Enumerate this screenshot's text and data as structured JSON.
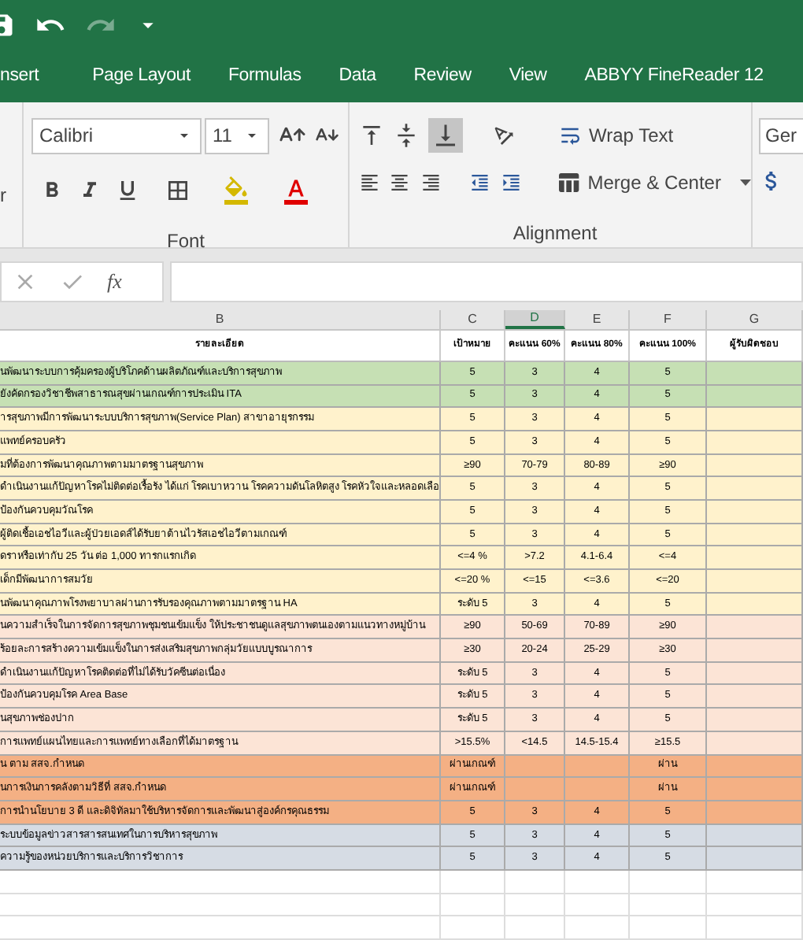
{
  "ribbon_tabs": [
    {
      "label": "nsert",
      "selected": false
    },
    {
      "label": "Page Layout",
      "selected": false
    },
    {
      "label": "Formulas",
      "selected": false
    },
    {
      "label": "Data",
      "selected": false
    },
    {
      "label": "Review",
      "selected": false
    },
    {
      "label": "View",
      "selected": false
    },
    {
      "label": "ABBYY FineReader 12",
      "selected": false
    }
  ],
  "clipboard_group": {
    "cut_label": "r"
  },
  "font_group": {
    "font_name": "Calibri",
    "font_size": "11",
    "label": "Font"
  },
  "alignment_group": {
    "wrap_text": "Wrap Text",
    "merge_center": "Merge & Center",
    "label": "Alignment",
    "bottom_align_selected": true
  },
  "number_group": {
    "format": "Ger"
  },
  "formula_bar": {
    "fx": "fx"
  },
  "columns": [
    {
      "letter": "B",
      "selected": false
    },
    {
      "letter": "C",
      "selected": false
    },
    {
      "letter": "D",
      "selected": true
    },
    {
      "letter": "E",
      "selected": false
    },
    {
      "letter": "F",
      "selected": false
    },
    {
      "letter": "G",
      "selected": false
    }
  ],
  "header_row": [
    "รายละเอียด",
    "เป้าหมาย",
    "คะแนน 60%",
    "คะแนน 80%",
    "คะแนน 100%",
    "ผู้รับผิดชอบ"
  ],
  "rows": [
    {
      "color": "#c6e0b4",
      "cells": [
        "นพัฒนาระบบการคุ้มครองผู้บริโภคด้านผลิตภัณฑ์และบริการสุขภาพ",
        "5",
        "3",
        "4",
        "5"
      ]
    },
    {
      "color": "#c6e0b4",
      "cells": [
        "ยังคัดกรองวิชาชีพสาธารณสุขผ่านเกณฑ์การประเมิน ITA",
        "5",
        "3",
        "4",
        "5"
      ]
    },
    {
      "color": "#fff2cc",
      "cells": [
        "ารสุขภาพมีการพัฒนาระบบบริการสุขภาพ(Service Plan) สาขาอายุรกรรม",
        "5",
        "3",
        "4",
        "5"
      ]
    },
    {
      "color": "#fff2cc",
      "cells": [
        "แพทย์ครอบครัว",
        "5",
        "3",
        "4",
        "5"
      ]
    },
    {
      "color": "#fff2cc",
      "cells": [
        "มที่ต้องการพัฒนาคุณภาพตามมาตรฐานสุขภาพ",
        "≥90",
        "70-79",
        "80-89",
        "≥90"
      ]
    },
    {
      "color": "#fff2cc",
      "cells": [
        "ดำเนินงานแก้ปัญหาโรคไม่ติดต่อเรื้อรัง ได้แก่ โรคเบาหวาน โรคความดันโลหิตสูง โรคหัวใจและหลอดเลือ",
        "5",
        "3",
        "4",
        "5"
      ]
    },
    {
      "color": "#fff2cc",
      "cells": [
        "ป้องกันควบคุมวัณโรค",
        "5",
        "3",
        "4",
        "5"
      ]
    },
    {
      "color": "#fff2cc",
      "cells": [
        "ผู้ติดเชื้อเอชไอวีและผู้ป่วยเอดส์ได้รับยาต้านไวรัสเอชไอวีตามเกณฑ์",
        "5",
        "3",
        "4",
        "5"
      ]
    },
    {
      "color": "#fff2cc",
      "cells": [
        "ดราหรือเท่ากับ 25 วัน ต่อ 1,000 ทารกแรกเกิด",
        "<=4 %",
        ">7.2",
        "4.1-6.4",
        "<=4"
      ]
    },
    {
      "color": "#fff2cc",
      "cells": [
        "เด็กมีพัฒนาการสมวัย",
        "<=20 %",
        "<=15",
        "<=3.6",
        "<=20"
      ]
    },
    {
      "color": "#fff2cc",
      "cells": [
        "นพัฒนาคุณภาพโรงพยาบาลผ่านการรับรองคุณภาพตามมาตรฐาน HA",
        "ระดับ 5",
        "3",
        "4",
        "5"
      ]
    },
    {
      "color": "#fce4d6",
      "cells": [
        "นความสำเร็จในการจัดการสุขภาพชุมชนเข้มแข็ง ให้ประชาชนดูแลสุขภาพตนเองตามแนวทางหมู่บ้าน",
        "≥90",
        "50-69",
        "70-89",
        "≥90"
      ]
    },
    {
      "color": "#fce4d6",
      "cells": [
        "ร้อยละการสร้างความเข้มแข็งในการส่งเสริมสุขภาพกลุ่มวัยแบบบูรณาการ",
        "≥30",
        "20-24",
        "25-29",
        "≥30"
      ]
    },
    {
      "color": "#fce4d6",
      "cells": [
        "ดำเนินงานแก้ปัญหาโรคติดต่อที่ไม่ได้รับวัคซีนต่อเนื่อง",
        "ระดับ 5",
        "3",
        "4",
        "5"
      ]
    },
    {
      "color": "#fce4d6",
      "cells": [
        "ป้องกันควบคุมโรค Area Base",
        "ระดับ 5",
        "3",
        "4",
        "5"
      ]
    },
    {
      "color": "#fce4d6",
      "cells": [
        "นสุขภาพช่องปาก",
        "ระดับ 5",
        "3",
        "4",
        "5"
      ]
    },
    {
      "color": "#fce4d6",
      "cells": [
        "การแพทย์แผนไทยและการแพทย์ทางเลือกที่ได้มาตรฐาน",
        ">15.5%",
        "<14.5",
        "14.5-15.4",
        "≥15.5"
      ]
    },
    {
      "color": "#f4b084",
      "cells": [
        "น ตาม สสจ.กำหนด",
        "ผ่านเกณฑ์",
        "",
        "",
        "ผ่าน"
      ]
    },
    {
      "color": "#f4b084",
      "cells": [
        "นการเงินการคลังตามวิธีที่ สสจ.กำหนด",
        "ผ่านเกณฑ์",
        "",
        "",
        "ผ่าน"
      ]
    },
    {
      "color": "#f4b084",
      "cells": [
        "การนำนโยบาย 3 ดี และดิจิทัลมาใช้บริหารจัดการและพัฒนาสู่องค์กรคุณธรรม",
        "5",
        "3",
        "4",
        "5"
      ]
    },
    {
      "color": "#d6dce4",
      "cells": [
        "ระบบข้อมูลข่าวสารสารสนเทศในการบริหารสุขภาพ",
        "5",
        "3",
        "4",
        "5"
      ]
    },
    {
      "color": "#d6dce4",
      "cells": [
        "ความรู้ของหน่วยบริการและบริการวิชาการ",
        "5",
        "3",
        "4",
        "5"
      ]
    }
  ]
}
